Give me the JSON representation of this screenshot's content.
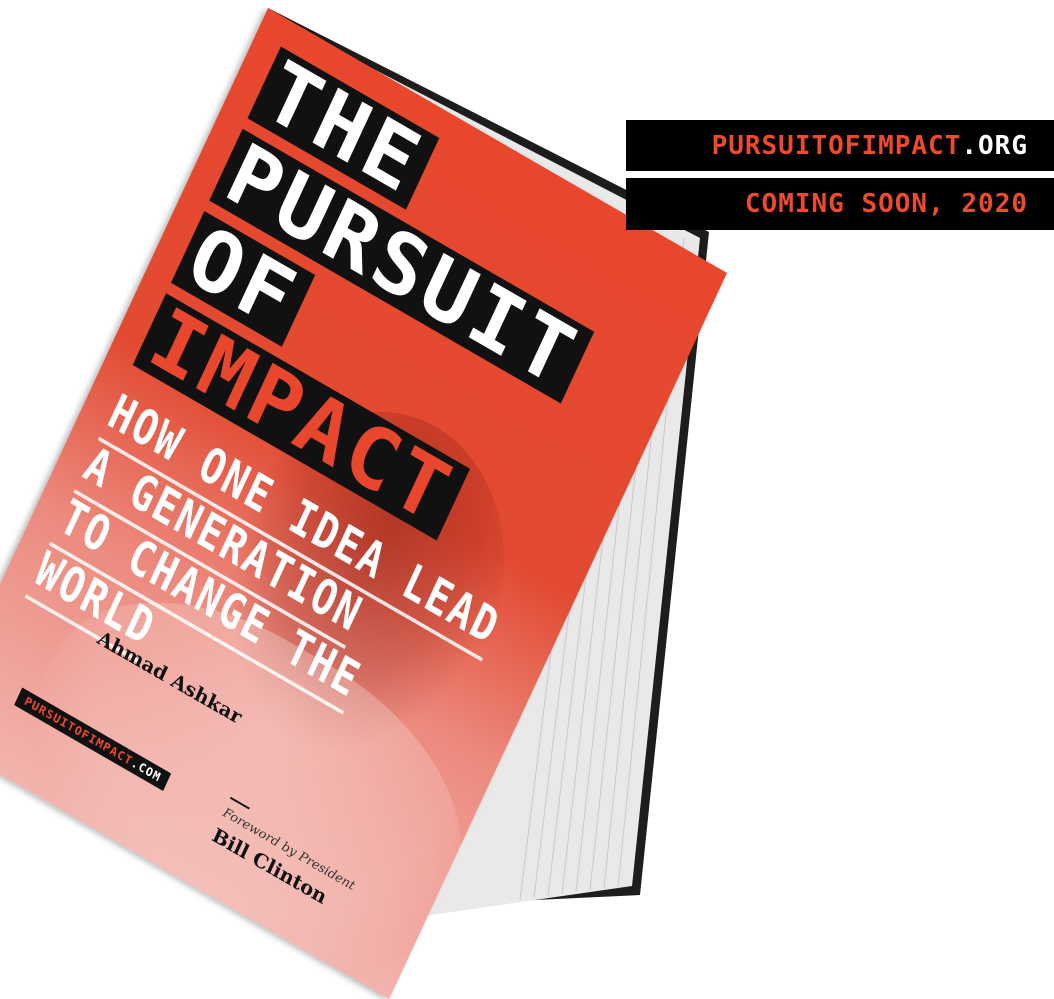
{
  "banner": {
    "url_accent": "PURSUITOFIMPACT",
    "url_rest": ".ORG",
    "coming_soon": "COMING SOON, 2020"
  },
  "book": {
    "title_lines": [
      "THE",
      "PURSUIT",
      "OF",
      "IMPACT"
    ],
    "subtitle_lines": [
      "HOW ONE IDEA LEAD",
      "A GENERATION",
      "TO CHANGE THE",
      "WORLD"
    ],
    "author": "Ahmad Ashkar",
    "cover_url_accent": "PURSUITOFIMPACT",
    "cover_url_rest": ".COM",
    "foreword_label": "Foreword by President",
    "foreword_name": "Bill Clinton"
  },
  "colors": {
    "accent": "#ef4a2c",
    "banner_bg": "#000000",
    "cover_red": "#e8472e"
  }
}
